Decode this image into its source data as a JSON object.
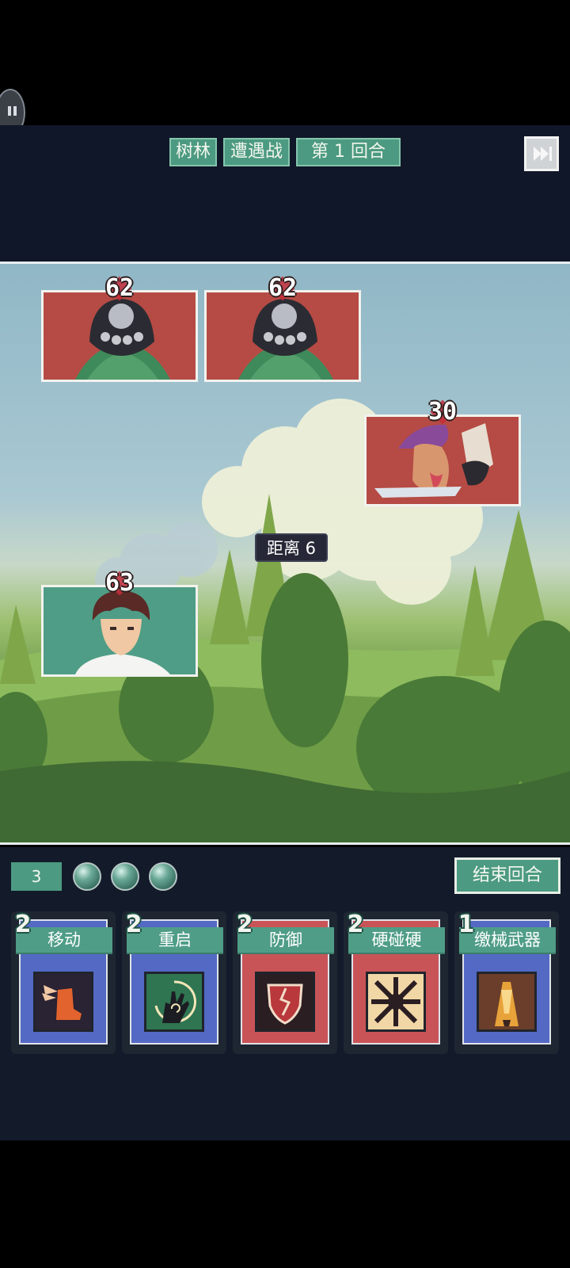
{
  "header": {
    "location": "树林",
    "battle_type": "遭遇战",
    "round": "第 1 回合"
  },
  "enemies": [
    {
      "name": "hooded-frog-enemy",
      "hp": "62"
    },
    {
      "name": "hooded-frog-enemy",
      "hp": "62"
    },
    {
      "name": "knife-bandit-enemy",
      "hp": "30"
    }
  ],
  "player": {
    "hp": "63"
  },
  "distance_label": "距离 6",
  "energy": "3",
  "energy_orbs": 3,
  "end_turn_label": "结束回合",
  "hand": [
    {
      "cost": "2",
      "name": "移动",
      "frame": "blue",
      "icon": "winged-boot-icon"
    },
    {
      "cost": "2",
      "name": "重启",
      "frame": "blue",
      "icon": "spiral-hand-icon"
    },
    {
      "cost": "2",
      "name": "防御",
      "frame": "red",
      "icon": "cracked-shield-icon"
    },
    {
      "cost": "2",
      "name": "硬碰硬",
      "frame": "red",
      "icon": "burst-icon"
    },
    {
      "cost": "1",
      "name": "缴械武器",
      "frame": "blue",
      "icon": "disarm-icon"
    }
  ],
  "colors": {
    "accent_green": "#4c9a81",
    "enemy_card_red": "#b54b44",
    "panel_bg": "#131b2b"
  }
}
